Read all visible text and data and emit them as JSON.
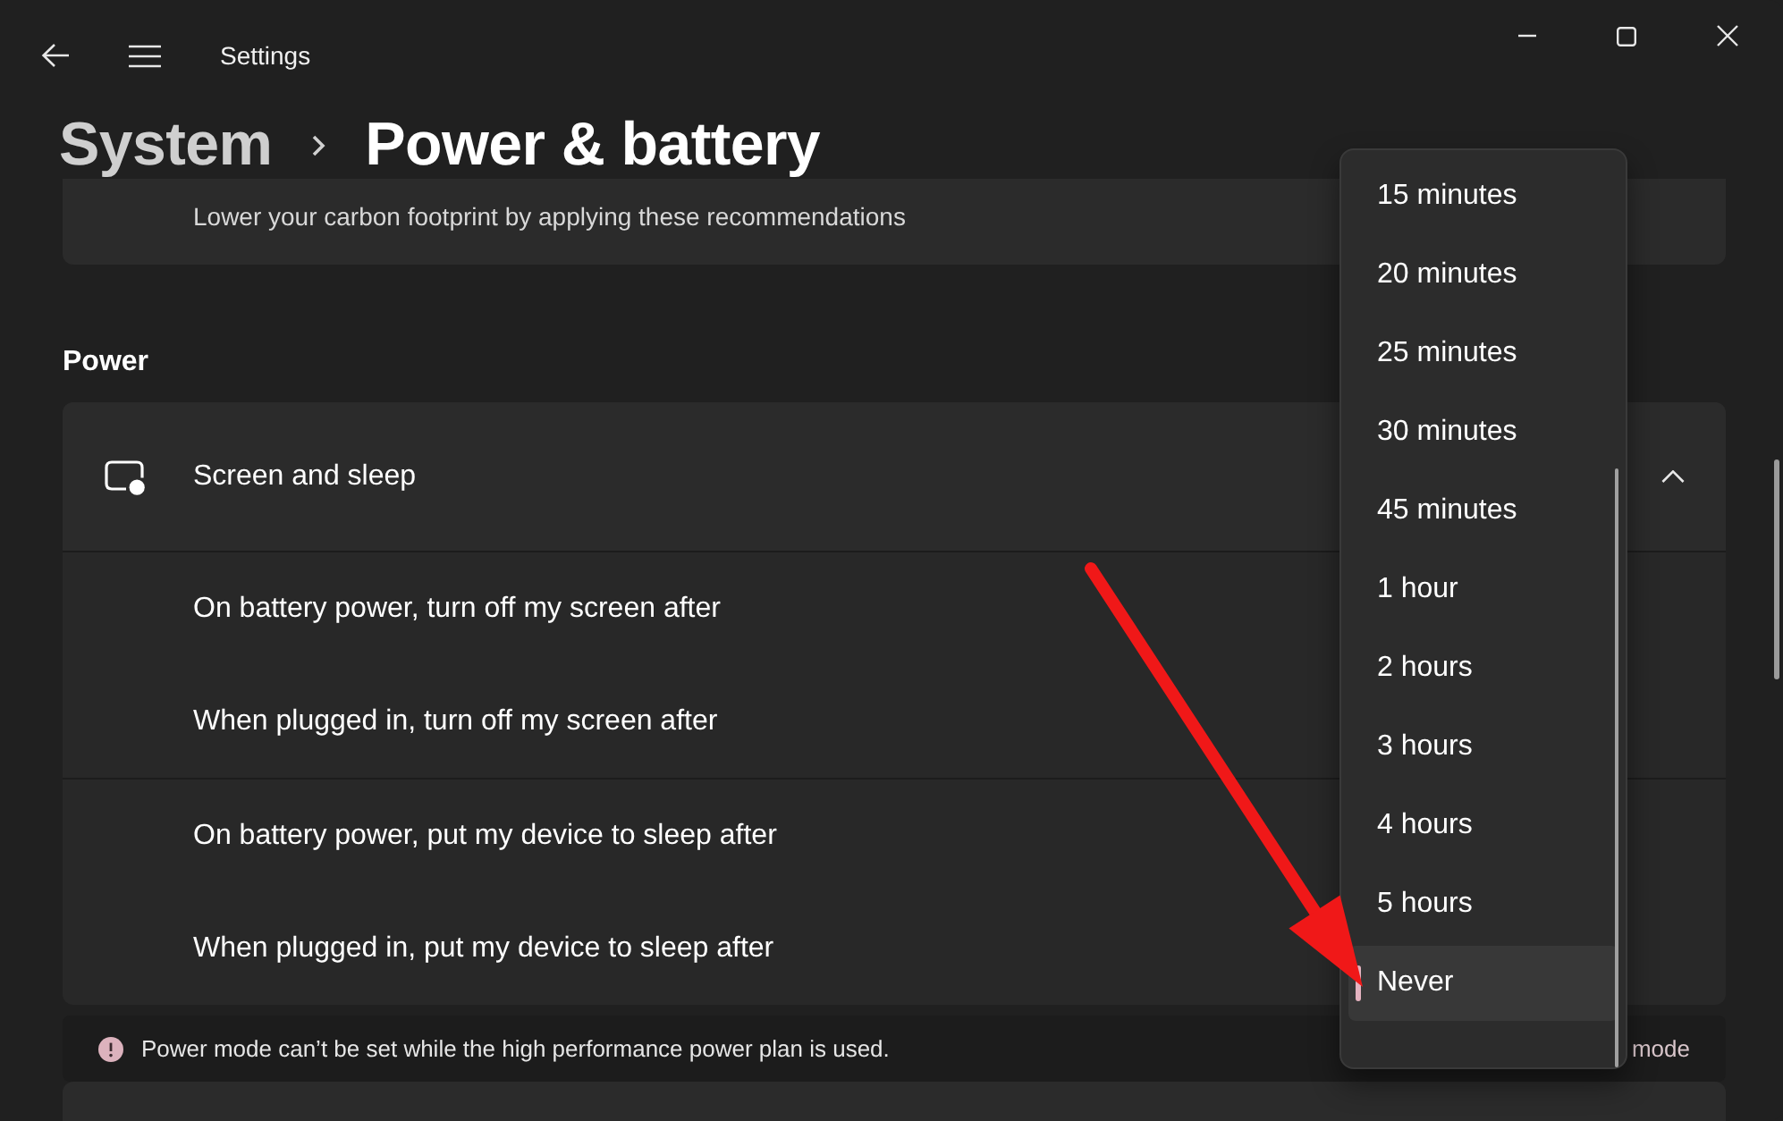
{
  "window": {
    "title": "Settings"
  },
  "breadcrumb": [
    {
      "label": "System",
      "selected": false
    },
    {
      "label": "Power & battery",
      "selected": true
    }
  ],
  "recommendation_card": {
    "description": "Lower your carbon footprint by applying these recommendations"
  },
  "power_section": {
    "heading": "Power",
    "screen_and_sleep": {
      "label": "Screen and sleep",
      "expanded": true,
      "groups": [
        {
          "settings": [
            {
              "label": "On battery power, turn off my screen after"
            },
            {
              "label": "When plugged in, turn off my screen after"
            }
          ]
        },
        {
          "settings": [
            {
              "label": "On battery power, put my device to sleep after"
            },
            {
              "label": "When plugged in, put my device to sleep after"
            }
          ]
        }
      ]
    }
  },
  "info_bar": {
    "message": "Power mode can’t be set while the high performance power plan is used.",
    "trailing_text": "mode"
  },
  "dropdown_menu": {
    "options": [
      {
        "label": "15 minutes",
        "selected": false
      },
      {
        "label": "20 minutes",
        "selected": false
      },
      {
        "label": "25 minutes",
        "selected": false
      },
      {
        "label": "30 minutes",
        "selected": false
      },
      {
        "label": "45 minutes",
        "selected": false
      },
      {
        "label": "1 hour",
        "selected": false
      },
      {
        "label": "2 hours",
        "selected": false
      },
      {
        "label": "3 hours",
        "selected": false
      },
      {
        "label": "4 hours",
        "selected": false
      },
      {
        "label": "5 hours",
        "selected": false
      },
      {
        "label": "Never",
        "selected": true
      }
    ]
  },
  "annotation": {
    "kind": "arrow"
  }
}
